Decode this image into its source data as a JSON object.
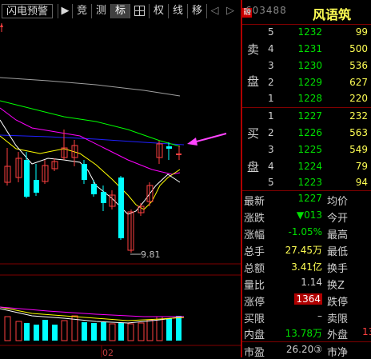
{
  "toolbar": {
    "items": [
      {
        "label": "闪电预警",
        "icon": "flash-warning"
      },
      {
        "label": "▶",
        "icon": "play-icon"
      },
      {
        "label": "竞"
      },
      {
        "label": "测"
      },
      {
        "label": "标",
        "active": true
      },
      {
        "label": "",
        "icon": "crosshair-grid-icon"
      },
      {
        "label": "权"
      },
      {
        "label": "线"
      },
      {
        "label": "移"
      }
    ]
  },
  "chart": {
    "low_label": "9.81",
    "date_label": "02",
    "colors": {
      "up": "#ff4040",
      "down": "#00ffff",
      "ma5": "#ffffff",
      "ma10": "#ffff00",
      "ma20": "#ff00ff",
      "ma60": "#00ff00",
      "ma120": "#0000ff",
      "ma250": "#a0a0a0"
    }
  },
  "quote": {
    "title": {
      "code": "603488",
      "name": "风语筑"
    },
    "sell": [
      {
        "label": "卖",
        "level": "5",
        "price": "1232",
        "volume": "99"
      },
      {
        "label": "",
        "level": "4",
        "price": "1231",
        "volume": "500"
      },
      {
        "label": "盘",
        "level": "3",
        "price": "1230",
        "volume": "536"
      },
      {
        "label": "",
        "level": "2",
        "price": "1229",
        "volume": "627"
      },
      {
        "label": "",
        "level": "1",
        "price": "1228",
        "volume": "220"
      }
    ],
    "buy": [
      {
        "label": "买",
        "level": "1",
        "price": "1227",
        "volume": "232"
      },
      {
        "label": "",
        "level": "2",
        "price": "1226",
        "volume": "563"
      },
      {
        "label": "盘",
        "level": "3",
        "price": "1225",
        "volume": "549"
      },
      {
        "label": "",
        "level": "4",
        "price": "1224",
        "volume": "79"
      },
      {
        "label": "",
        "level": "5",
        "price": "1223",
        "volume": "94"
      }
    ],
    "stats": [
      {
        "l1": "最新",
        "v1": "1227",
        "c1": "green",
        "l2": "均价",
        "v2": ""
      },
      {
        "l1": "涨跌",
        "v1": "▼013",
        "c1": "green",
        "l2": "今开",
        "v2": ""
      },
      {
        "l1": "涨幅",
        "v1": "-1.05%",
        "c1": "green",
        "l2": "最高",
        "v2": ""
      },
      {
        "l1": "总手",
        "v1": "27.45万",
        "c1": "yellow",
        "l2": "最低",
        "v2": ""
      },
      {
        "l1": "总额",
        "v1": "3.41亿",
        "c1": "yellow",
        "l2": "换手",
        "v2": ""
      },
      {
        "l1": "量比",
        "v1": "1.14",
        "c1": "white",
        "l2": "换Z",
        "v2": ""
      },
      {
        "l1": "涨停",
        "v1": "1364",
        "c1": "redbox",
        "l2": "跌停",
        "v2": ""
      },
      {
        "l1": "买限",
        "v1": "–",
        "c1": "white",
        "l2": "卖限",
        "v2": ""
      },
      {
        "l1": "内盘",
        "v1": "13.78万",
        "c1": "green",
        "l2": "外盘",
        "v2": "13"
      },
      {
        "l1": "市盈",
        "v1": "26.20③",
        "c1": "white",
        "l2": "市净",
        "v2": ""
      }
    ]
  }
}
